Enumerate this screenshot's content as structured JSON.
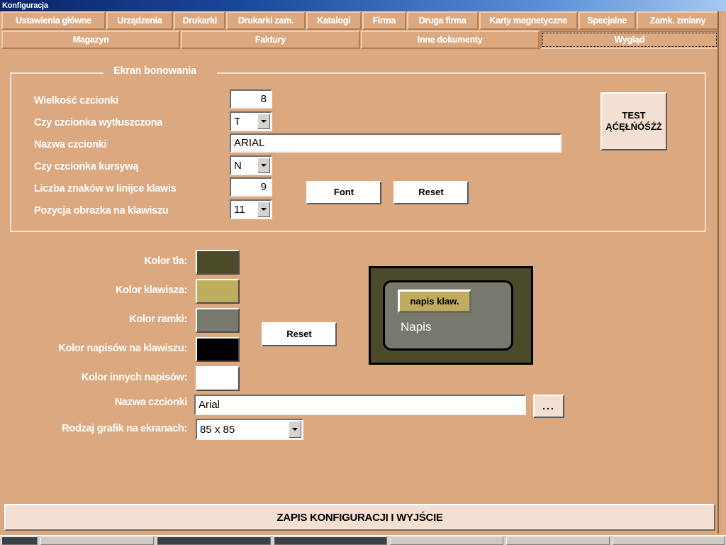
{
  "window": {
    "title": "Konfiguracja"
  },
  "tabs": {
    "row1": [
      {
        "label": "Ustawienia główne",
        "selected": false
      },
      {
        "label": "Urządzenia",
        "selected": false
      },
      {
        "label": "Drukarki",
        "selected": false
      },
      {
        "label": "Drukarki zam.",
        "selected": false
      },
      {
        "label": "Katalogi",
        "selected": false
      },
      {
        "label": "Firma",
        "selected": false
      },
      {
        "label": "Druga firma",
        "selected": false
      },
      {
        "label": "Karty magnetyczne",
        "selected": false
      },
      {
        "label": "Specjalne",
        "selected": false
      },
      {
        "label": "Zamk. zmiany",
        "selected": false
      }
    ],
    "row2": [
      {
        "label": "Magazyn",
        "selected": false
      },
      {
        "label": "Faktury",
        "selected": false
      },
      {
        "label": "Inne dokumenty",
        "selected": false
      },
      {
        "label": "Wygląd",
        "selected": true
      }
    ]
  },
  "groupbox": {
    "title": "Ekran bonowania",
    "rows": [
      {
        "label": "Wielkość czcionki",
        "value": "8",
        "control": "number"
      },
      {
        "label": "Czy czcionka wytłuszczona",
        "value": "T",
        "control": "combo"
      },
      {
        "label": "Nazwa czcionki",
        "value": "ARIAL",
        "control": "text"
      },
      {
        "label": "Czy czcionka kursywą",
        "value": "N",
        "control": "combo"
      },
      {
        "label": "Liczba znaków w linijce klawis",
        "value": "9",
        "control": "number"
      },
      {
        "label": "Pozycja obrazka na klawiszu",
        "value": "11",
        "control": "combo"
      }
    ],
    "font_button": "Font",
    "reset_button": "Reset",
    "test_button_line1": "TEST",
    "test_button_line2": "ĄĆĘŁŃÓŚŹŻ"
  },
  "colors": {
    "rows": [
      {
        "label": "Kolor tła:",
        "hex": "#4b4a29"
      },
      {
        "label": "Kolor klawisza:",
        "hex": "#c0ac5f"
      },
      {
        "label": "Kolor ramki:",
        "hex": "#78786f"
      },
      {
        "label": "Kolor napisów na klawiszu:",
        "hex": "#000000"
      },
      {
        "label": "Kolor innych napisów:",
        "hex": "#ffffff"
      }
    ],
    "reset_button": "Reset"
  },
  "preview": {
    "key_label": "napis klaw.",
    "caption": "Napis",
    "background_hex": "#4b4a29",
    "frame_hex": "#78786f",
    "key_hex": "#c0ac5f",
    "key_text_hex": "#000000",
    "caption_text_hex": "#ffffff"
  },
  "font_row": {
    "label": "Nazwa czcionki",
    "value": "Arial",
    "browse_button": "..."
  },
  "graphics_row": {
    "label": "Rodzaj  grafik na ekranach:",
    "value": "85 x 85"
  },
  "bottom": {
    "save_exit_label": "ZAPIS KONFIGURACJI I WYJŚCIE"
  },
  "theme": {
    "window_background": "#dba880",
    "label_text": "#ffffff",
    "button_face": "#f3e0d2",
    "titlebar_start": "#0a246a",
    "titlebar_end": "#a6c8f0"
  }
}
